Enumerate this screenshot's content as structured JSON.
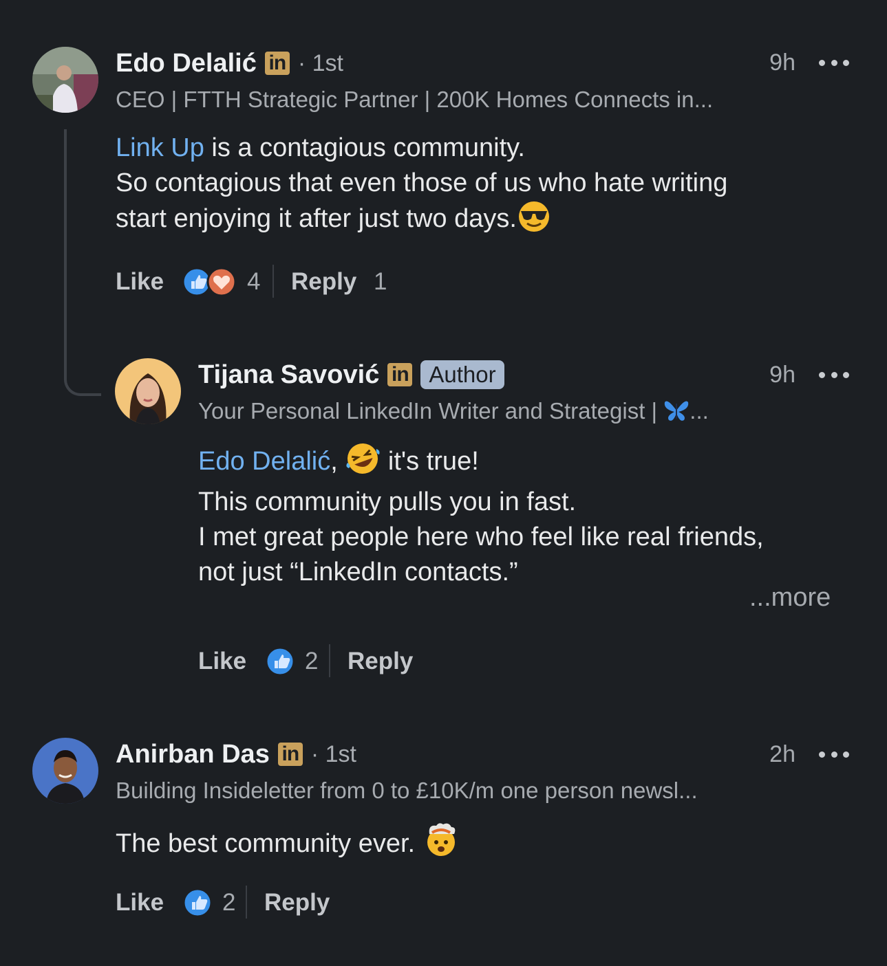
{
  "comments": [
    {
      "name": "Edo Delalić",
      "degree": "· 1st",
      "time": "9h",
      "headline": "CEO | FTTH Strategic Partner | 200K Homes Connects in...",
      "mention": "Link Up",
      "text_line1": " is a contagious community.",
      "text_line2": "So contagious that even those of us who hate writing",
      "text_line3": "start enjoying it after just two days.",
      "emoji": "smiling-face-with-sunglasses",
      "like_label": "Like",
      "reaction_count": "4",
      "reply_label": "Reply",
      "reply_count": "1"
    },
    {
      "name": "Tijana Savović",
      "author_badge": "Author",
      "time": "9h",
      "headline": "Your Personal LinkedIn Writer and Strategist |",
      "headline_emoji": "butterfly",
      "headline_ellipsis": "...",
      "mention": "Edo Delalić",
      "text_line1_suffix": "it's true!",
      "emoji": "rolling-on-the-floor-laughing",
      "text_line2": "This community pulls you in fast.",
      "text_line3": "I met great people here who feel like real friends,",
      "text_line4": "not just “LinkedIn contacts.”",
      "more_label": "...more",
      "like_label": "Like",
      "reaction_count": "2",
      "reply_label": "Reply"
    },
    {
      "name": "Anirban Das",
      "degree": "· 1st",
      "time": "2h",
      "headline": "Building Insideletter from 0 to £10K/m one person newsl...",
      "text_line1": "The best community ever.",
      "emoji": "exploding-head",
      "like_label": "Like",
      "reaction_count": "2",
      "reply_label": "Reply"
    }
  ],
  "linkedin_badge": "in",
  "colors": {
    "background": "#1c1f23",
    "mention": "#71b1f0",
    "like_blue": "#378fe9",
    "love_red": "#df704d",
    "badge_gold": "#c9a15c",
    "author_pill": "#a9b9cf"
  }
}
